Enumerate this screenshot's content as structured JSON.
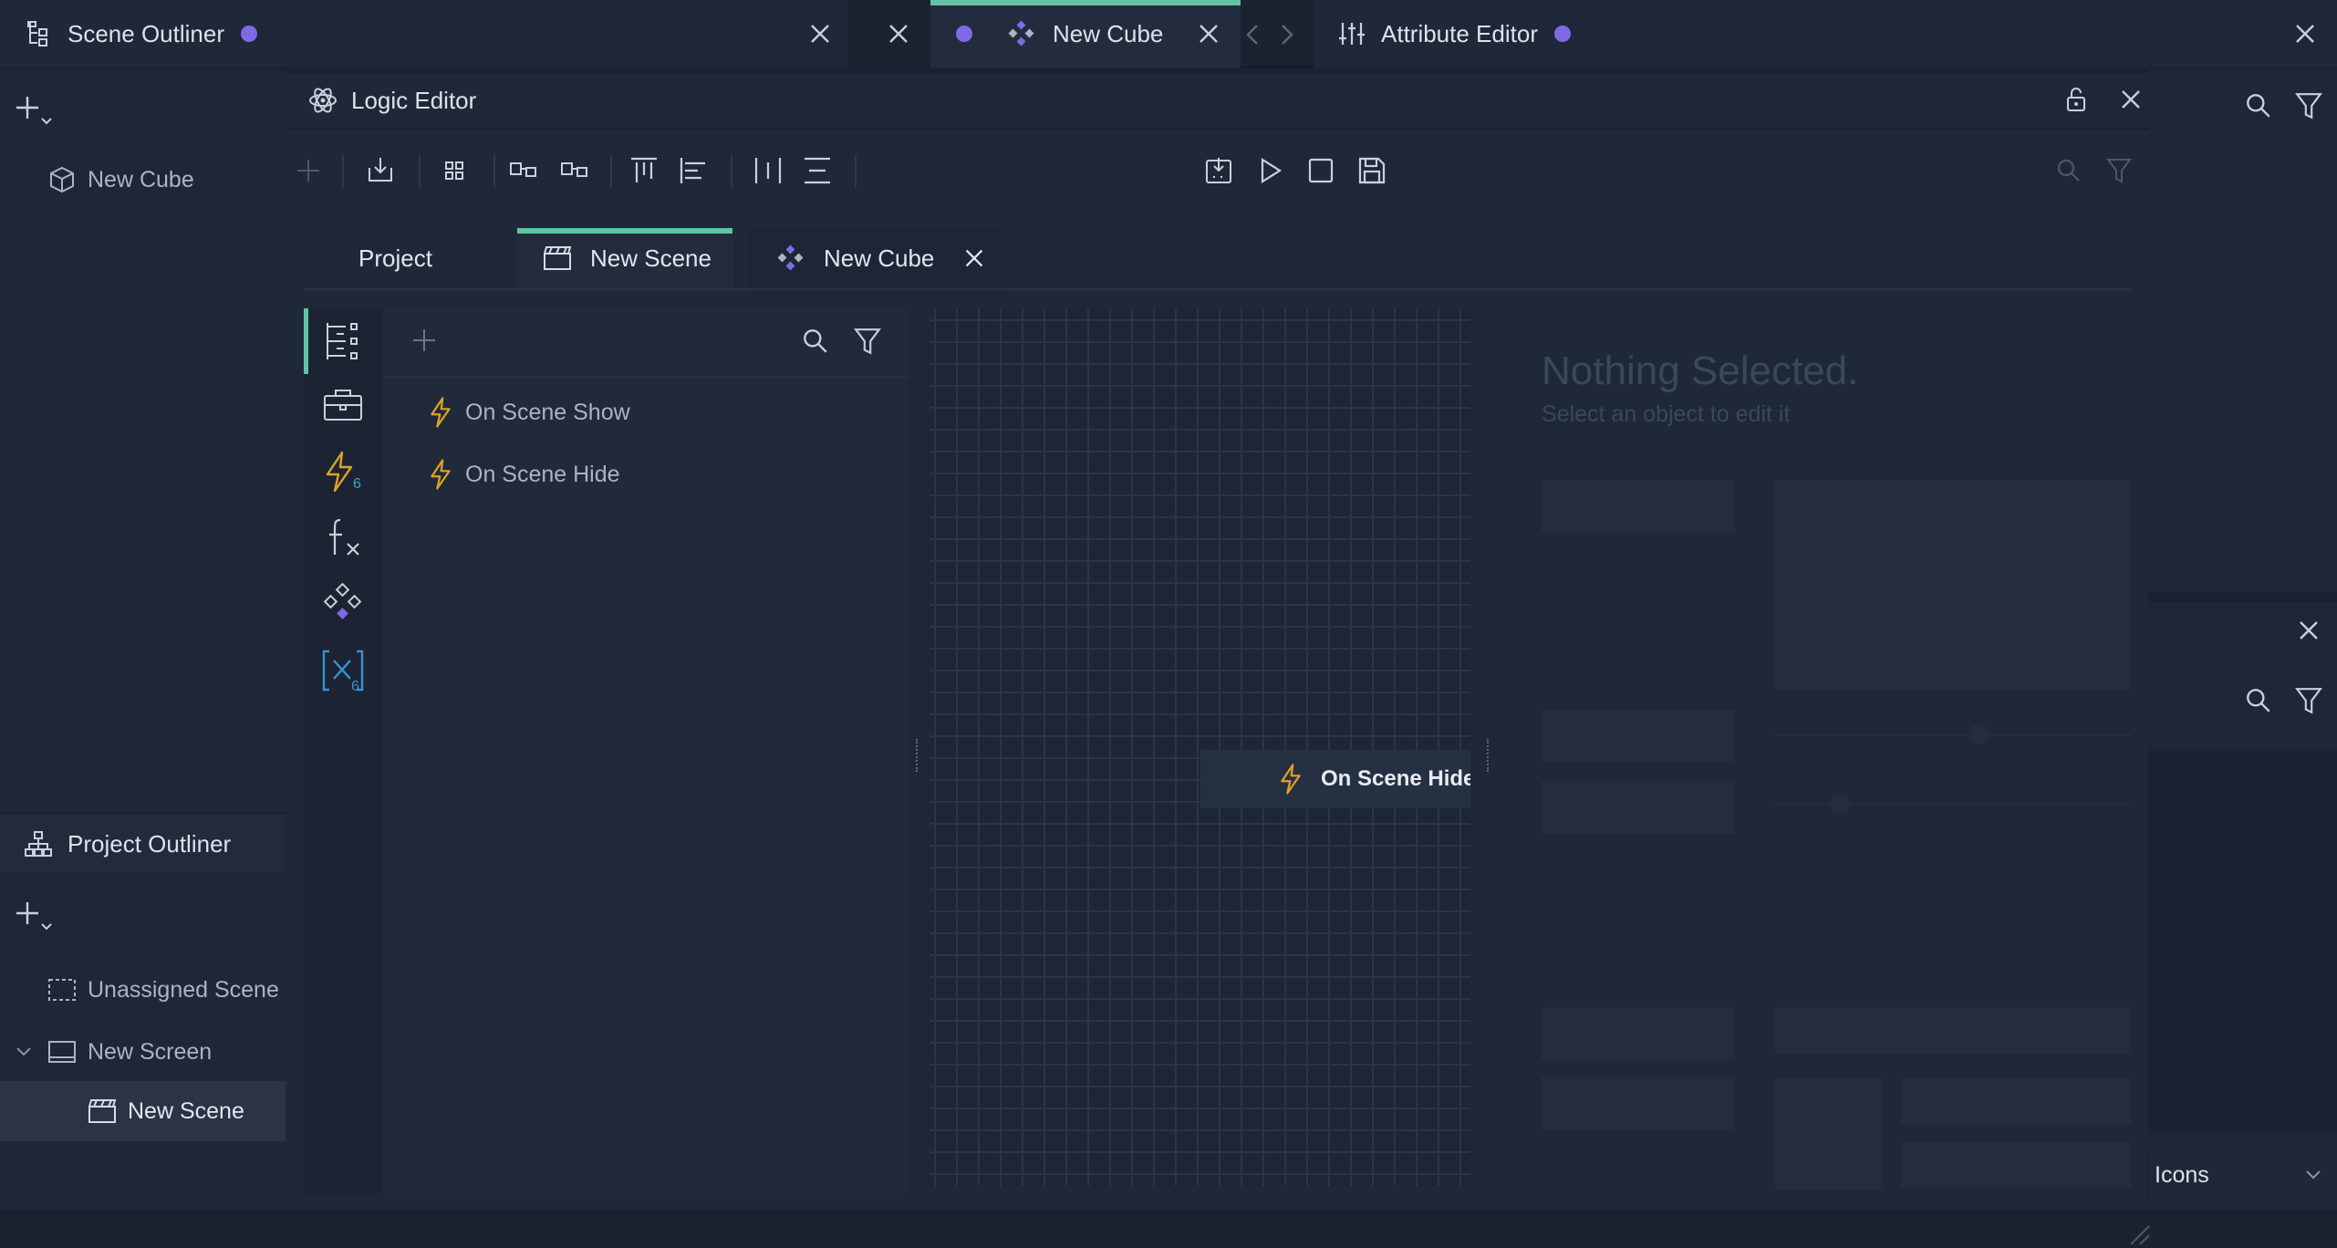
{
  "top_tabs": {
    "scene_outliner": "Scene Outliner",
    "new_cube": "New Cube",
    "attribute_editor": "Attribute Editor"
  },
  "scene_outliner": {
    "items": [
      {
        "label": "New Cube"
      }
    ]
  },
  "project_outliner": {
    "title": "Project Outliner",
    "items": [
      {
        "label": "Unassigned Scene"
      },
      {
        "label": "New Screen"
      },
      {
        "label": "New Scene"
      }
    ]
  },
  "logic_editor": {
    "title": "Logic Editor",
    "tabs": [
      {
        "label": "Project"
      },
      {
        "label": "New Scene"
      },
      {
        "label": "New Cube"
      }
    ],
    "events": [
      {
        "label": "On Scene Show"
      },
      {
        "label": "On Scene Hide"
      }
    ],
    "rail_badge": "6",
    "rail_badge2": "6",
    "canvas_node": "On Scene Hide",
    "inspector": {
      "heading": "Nothing Selected.",
      "subheading": "Select an object to edit it"
    }
  },
  "right_panel": {
    "dropdown_value": "Icons"
  },
  "colors": {
    "accent": "#63c3a2",
    "dot": "#8169e6",
    "event_icon": "#e0a126",
    "variable": "#3a8fd6",
    "cube_icon": "#7e6be0"
  }
}
